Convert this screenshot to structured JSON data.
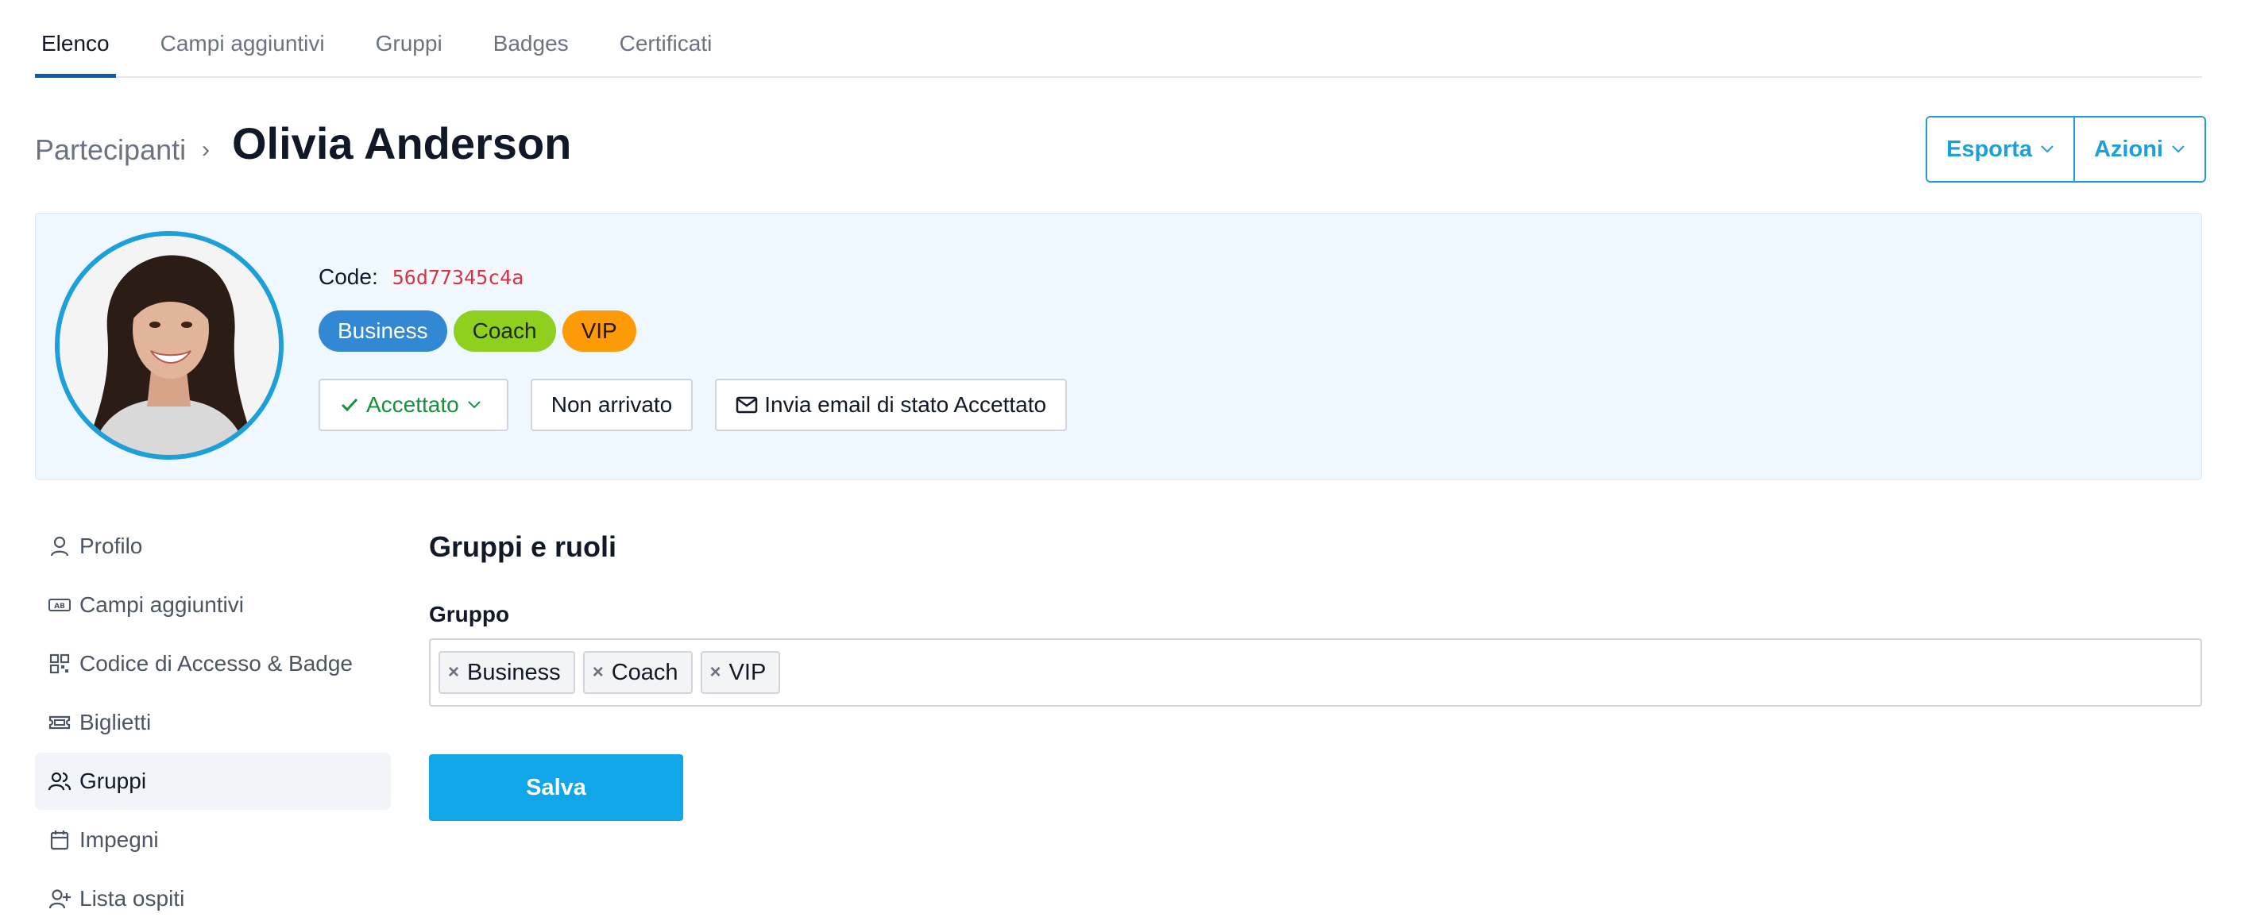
{
  "tabs": [
    {
      "label": "Elenco",
      "active": true
    },
    {
      "label": "Campi aggiuntivi",
      "active": false
    },
    {
      "label": "Gruppi",
      "active": false
    },
    {
      "label": "Badges",
      "active": false
    },
    {
      "label": "Certificati",
      "active": false
    }
  ],
  "breadcrumb": {
    "parent": "Partecipanti",
    "separator": "›",
    "current": "Olivia Anderson"
  },
  "header_actions": {
    "export_label": "Esporta",
    "actions_label": "Azioni"
  },
  "profile": {
    "code_label": "Code:",
    "code_value": "56d77345c4a",
    "badges": [
      {
        "label": "Business",
        "color": "#3388d4"
      },
      {
        "label": "Coach",
        "color": "#8fd01e"
      },
      {
        "label": "VIP",
        "color": "#fd9a07"
      }
    ],
    "status_label": "Accettato",
    "not_arrived_label": "Non arrivato",
    "email_label": "Invia email di stato Accettato"
  },
  "sidenav": {
    "items": [
      {
        "label": "Profilo",
        "icon": "user-icon",
        "active": false
      },
      {
        "label": "Campi aggiuntivi",
        "icon": "ab-field-icon",
        "active": false
      },
      {
        "label": "Codice di Accesso & Badge",
        "icon": "qr-code-icon",
        "active": false
      },
      {
        "label": "Biglietti",
        "icon": "ticket-icon",
        "active": false
      },
      {
        "label": "Gruppi",
        "icon": "users-icon",
        "active": true
      },
      {
        "label": "Impegni",
        "icon": "calendar-icon",
        "active": false
      },
      {
        "label": "Lista ospiti",
        "icon": "user-plus-icon",
        "active": false
      }
    ]
  },
  "main": {
    "section_title": "Gruppi e ruoli",
    "field_label": "Gruppo",
    "selected_groups": [
      "Business",
      "Coach",
      "VIP"
    ],
    "save_label": "Salva"
  },
  "colors": {
    "accent": "#1d9fda",
    "save_button": "#10a6e8",
    "accepted": "#13923b",
    "code": "#d1344b",
    "panel_bg": "#eff8fe"
  }
}
